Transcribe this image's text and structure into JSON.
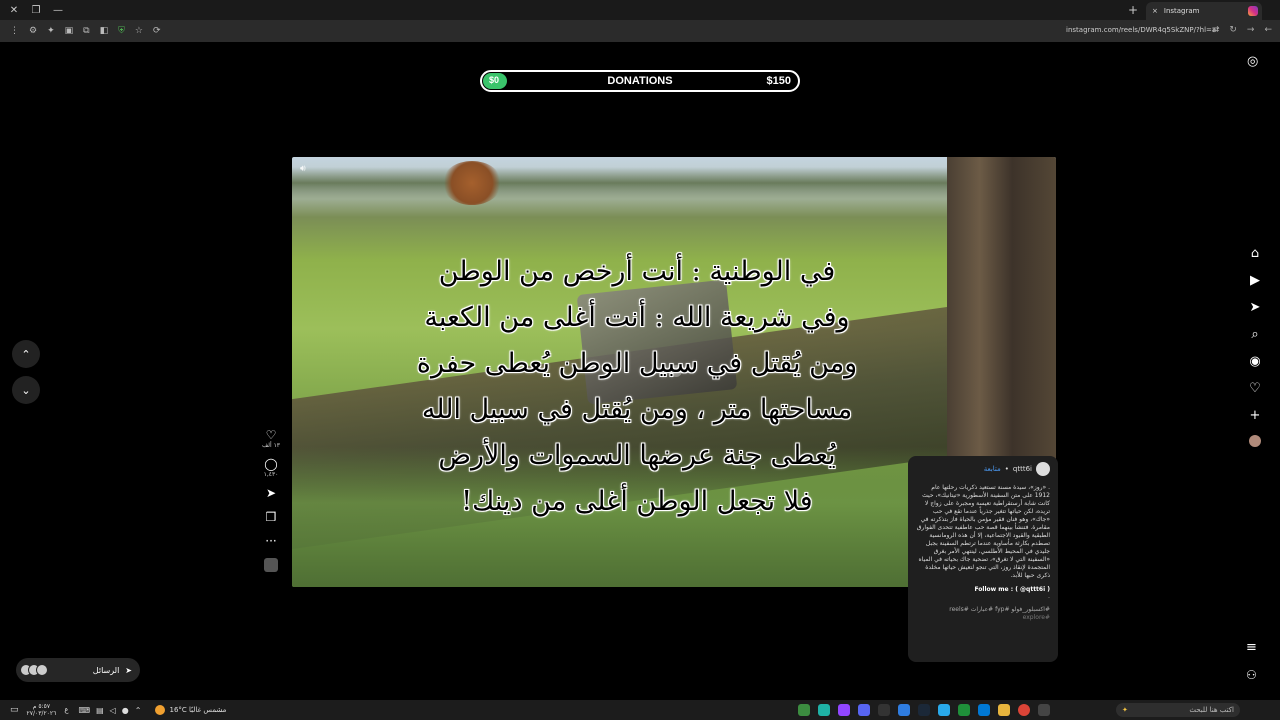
{
  "browser": {
    "tab_title": "Instagram",
    "url": "instagram.com/reels/DWR4q5SkZNP/?hl=ar",
    "new_tab_glyph": "+",
    "close_tab_glyph": "×"
  },
  "donation": {
    "current": "$0",
    "title": "DONATIONS",
    "goal": "$150",
    "progress_fraction": 0.0,
    "accent_color": "#3ac46b"
  },
  "reel": {
    "caption_lines": [
      "في الوطنية : أنت أرخص من الوطن",
      "وفي شريعة الله : أنت أغلى من الكعبة",
      "ومن يُقتل في سبيل الوطن يُعطى حفرة",
      "مساحتها متر ، ومن يُقتل في سبيل الله",
      "يُعطى جنة عرضها السموات والأرض",
      "فلا تجعل الوطن أغلى من دينك!"
    ],
    "likes_count": "١٣ ألف",
    "comments_count": "١,٤٣٠"
  },
  "post_card": {
    "username": "qttt6i",
    "follow_label": "متابعة",
    "separator": "•",
    "description": ". «روز»، سيدة مسنة تستعيد ذكريات رحلتها عام 1912 على متن السفينة الأسطورية «تيتانيك»، حيث كانت شابة أرستقراطية تعيسة ومجبرة على زواج لا تريده، لكن حياتها تتغير جذرياً عندما تقع في حب «جاك»، وهو فنان فقير مؤمن بالحياة فاز بتذكرته في مقامرة. فتنشأ بينهما قصة حب عاطفية تتحدى الفوارق الطبقية والقيود الاجتماعية، إلا أن هذه الرومانسية تصطدم بكارثة مأساوية عندما ترتطم السفينة بجبل جليدي في المحيط الأطلسي، لينتهي الأمر بغرق «السفينة التي لا تغرق»، تضحية جاك بحياته في المياه المتجمدة لإنقاذ روز، التي تنجو لتعيش حياتها مخلدة ذكرى حبها للأبد.",
    "follow_line": "Follow me : ( @qttt6i )",
    "dash": "-",
    "tags": "#اكسبلور_فولو #fyp #عبارات #reels",
    "more": "#explore"
  },
  "messages": {
    "label": "الرسائل"
  },
  "taskbar": {
    "time": "٥:٥٧ م",
    "date": "٢٧/٠٣/٢٠٢٦",
    "weather": "16°C مشمس غالبًا",
    "search_placeholder": "اكتب هنا للبحث",
    "lang": "ع"
  }
}
